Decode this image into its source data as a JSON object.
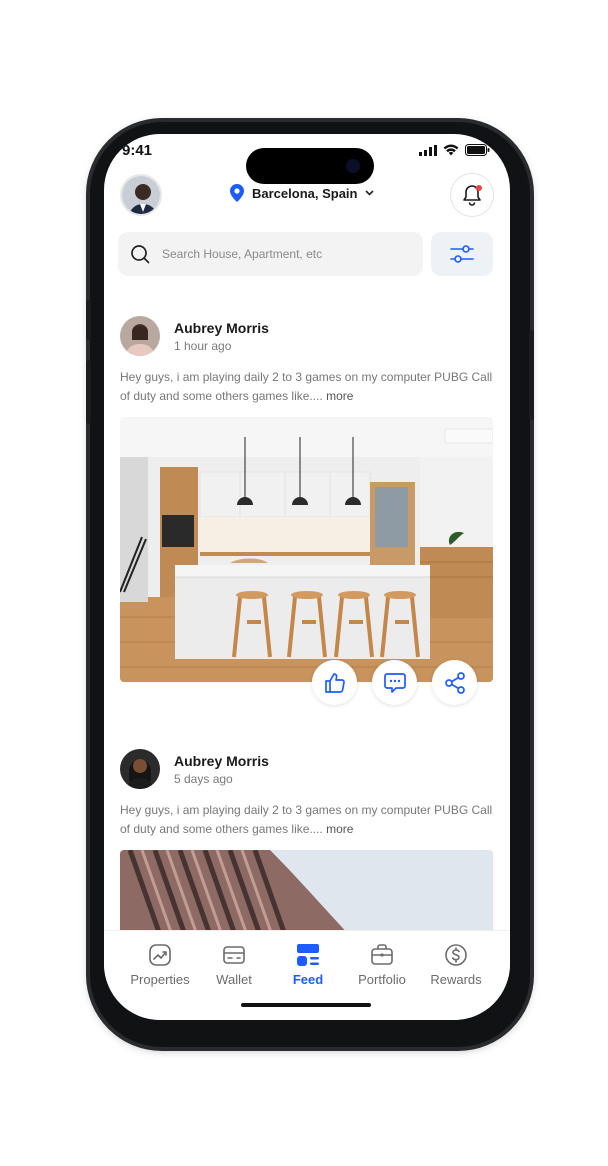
{
  "status": {
    "time": "9:41"
  },
  "header": {
    "location": "Barcelona, Spain"
  },
  "search": {
    "placeholder": "Search House, Apartment, etc"
  },
  "posts": [
    {
      "author": "Aubrey Morris",
      "time": "1 hour ago",
      "text": "Hey guys, i am playing daily 2 to 3 games on my computer PUBG Call of duty and some others games like.... ",
      "more": "more"
    },
    {
      "author": "Aubrey Morris",
      "time": "5 days ago",
      "text": "Hey guys, i am playing daily 2 to 3 games on my computer PUBG Call of duty and some others games like.... ",
      "more": "more"
    }
  ],
  "tabs": [
    {
      "label": "Properties",
      "icon": "chart-icon"
    },
    {
      "label": "Wallet",
      "icon": "wallet-icon"
    },
    {
      "label": "Feed",
      "icon": "feed-icon",
      "active": true
    },
    {
      "label": "Portfolio",
      "icon": "briefcase-icon"
    },
    {
      "label": "Rewards",
      "icon": "dollar-icon"
    }
  ],
  "colors": {
    "accent": "#1d5cff",
    "notification": "#ef4444"
  }
}
